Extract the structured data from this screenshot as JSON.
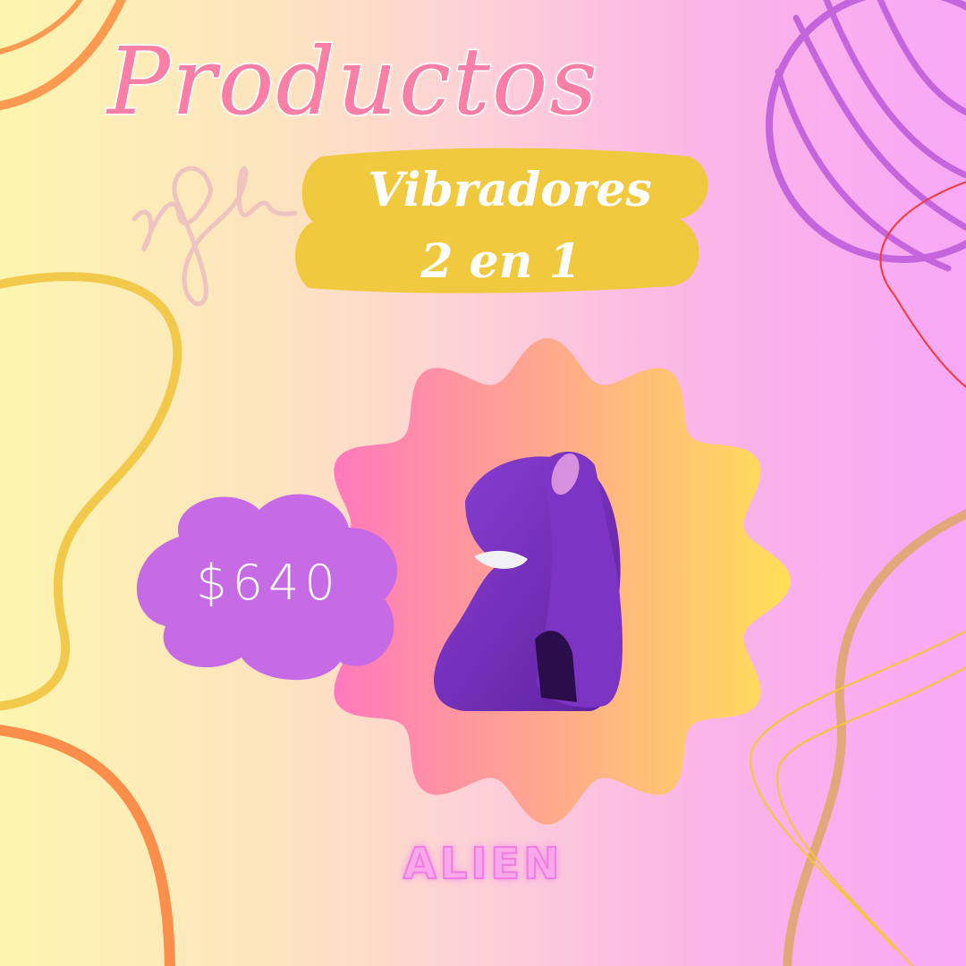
{
  "header": {
    "title": "Productos",
    "subtitle_line1": "Vibradores",
    "subtitle_line2": "2 en 1"
  },
  "product": {
    "price": "$640",
    "name": "ALIEN"
  },
  "signature": {
    "text": "yGh"
  },
  "colors": {
    "title": "#f97fa6",
    "banner": "#f1c93f",
    "price_cloud": "#c76ae6",
    "product": "#7b34c4",
    "badge_left": "#ff72c2",
    "badge_right": "#ffdf58"
  }
}
